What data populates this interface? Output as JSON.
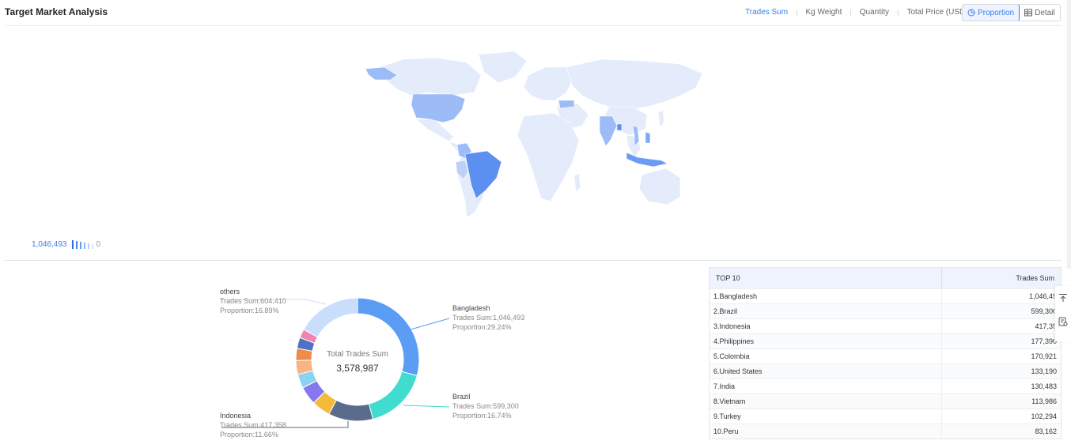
{
  "header": {
    "title": "Target Market Analysis",
    "tabs": [
      "Trades Sum",
      "Kg Weight",
      "Quantity",
      "Total Price (USD)"
    ],
    "active_tab": "Trades Sum",
    "view_toggle": {
      "proportion": "Proportion",
      "detail": "Detail",
      "active": "Proportion"
    }
  },
  "map_legend": {
    "max": "1,046,493",
    "min": "0"
  },
  "donut": {
    "center_title": "Total Trades Sum",
    "center_value": "3,578,987",
    "labels": {
      "bangladesh": {
        "name": "Bangladesh",
        "sum": "Trades Sum:1,046,493",
        "prop": "Proportion:29.24%"
      },
      "brazil": {
        "name": "Brazil",
        "sum": "Trades Sum:599,300",
        "prop": "Proportion:16.74%"
      },
      "indonesia": {
        "name": "Indonesia",
        "sum": "Trades Sum:417,358",
        "prop": "Proportion:11.66%"
      },
      "others": {
        "name": "others",
        "sum": "Trades Sum:604,410",
        "prop": "Proportion:16.89%"
      }
    },
    "segments": [
      {
        "name": "Bangladesh",
        "value": 1046493,
        "color": "#5b9cf5"
      },
      {
        "name": "Brazil",
        "value": 599300,
        "color": "#3fdccf"
      },
      {
        "name": "Indonesia",
        "value": 417358,
        "color": "#5a6b8c"
      },
      {
        "name": "Philippines",
        "value": 177390,
        "color": "#f3ba3c"
      },
      {
        "name": "Colombia",
        "value": 170921,
        "color": "#8677ee"
      },
      {
        "name": "United States",
        "value": 133190,
        "color": "#8cd3f2"
      },
      {
        "name": "India",
        "value": 130483,
        "color": "#f8b483"
      },
      {
        "name": "Vietnam",
        "value": 113986,
        "color": "#f08c4a"
      },
      {
        "name": "Turkey",
        "value": 102294,
        "color": "#4f72c7"
      },
      {
        "name": "Peru",
        "value": 83162,
        "color": "#ee84b0"
      },
      {
        "name": "others",
        "value": 604410,
        "color": "#c9defb"
      }
    ]
  },
  "table": {
    "headers": [
      "TOP 10",
      "Trades Sum"
    ],
    "rows": [
      [
        "1.Bangladesh",
        "1,046,49"
      ],
      [
        "2.Brazil",
        "599,300"
      ],
      [
        "3.Indonesia",
        "417,35"
      ],
      [
        "4.Philippines",
        "177,390"
      ],
      [
        "5.Colombia",
        "170,921"
      ],
      [
        "6.United States",
        "133,190"
      ],
      [
        "7.India",
        "130,483"
      ],
      [
        "8.Vietnam",
        "113,986"
      ],
      [
        "9.Turkey",
        "102,294"
      ],
      [
        "10.Peru",
        "83,162"
      ]
    ]
  },
  "colors": {
    "accent": "#3b7de8",
    "map_base": "#e4ecfb",
    "map_high": "#5b8ff0",
    "map_mid": "#9dbcf7"
  }
}
